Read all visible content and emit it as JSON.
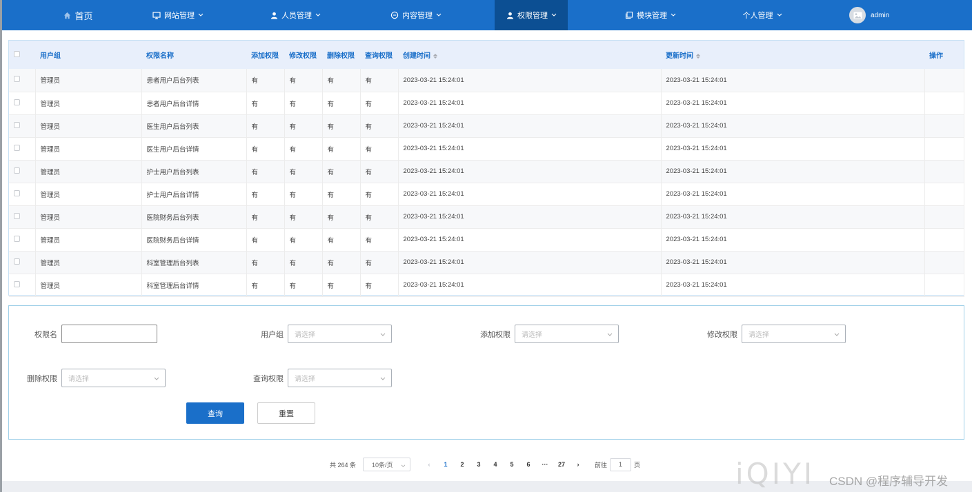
{
  "nav": {
    "home": "首页",
    "site": "网站管理",
    "staff": "人员管理",
    "content": "内容管理",
    "perm": "权限管理",
    "module": "模块管理",
    "personal": "个人管理",
    "user": "admin"
  },
  "table": {
    "headers": [
      "用户组",
      "权限名称",
      "添加权限",
      "修改权限",
      "删除权限",
      "查询权限",
      "创建时间",
      "更新时间",
      "操作"
    ],
    "rows": [
      [
        "管理员",
        "患者用户后台列表",
        "有",
        "有",
        "有",
        "有",
        "2023-03-21 15:24:01",
        "2023-03-21 15:24:01"
      ],
      [
        "管理员",
        "患者用户后台详情",
        "有",
        "有",
        "有",
        "有",
        "2023-03-21 15:24:01",
        "2023-03-21 15:24:01"
      ],
      [
        "管理员",
        "医生用户后台列表",
        "有",
        "有",
        "有",
        "有",
        "2023-03-21 15:24:01",
        "2023-03-21 15:24:01"
      ],
      [
        "管理员",
        "医生用户后台详情",
        "有",
        "有",
        "有",
        "有",
        "2023-03-21 15:24:01",
        "2023-03-21 15:24:01"
      ],
      [
        "管理员",
        "护士用户后台列表",
        "有",
        "有",
        "有",
        "有",
        "2023-03-21 15:24:01",
        "2023-03-21 15:24:01"
      ],
      [
        "管理员",
        "护士用户后台详情",
        "有",
        "有",
        "有",
        "有",
        "2023-03-21 15:24:01",
        "2023-03-21 15:24:01"
      ],
      [
        "管理员",
        "医院财务后台列表",
        "有",
        "有",
        "有",
        "有",
        "2023-03-21 15:24:01",
        "2023-03-21 15:24:01"
      ],
      [
        "管理员",
        "医院财务后台详情",
        "有",
        "有",
        "有",
        "有",
        "2023-03-21 15:24:01",
        "2023-03-21 15:24:01"
      ],
      [
        "管理员",
        "科室管理后台列表",
        "有",
        "有",
        "有",
        "有",
        "2023-03-21 15:24:01",
        "2023-03-21 15:24:01"
      ],
      [
        "管理员",
        "科室管理后台详情",
        "有",
        "有",
        "有",
        "有",
        "2023-03-21 15:24:01",
        "2023-03-21 15:24:01"
      ]
    ]
  },
  "search": {
    "perm_name_label": "权限名",
    "perm_name_value": "",
    "group_label": "用户组",
    "add_label": "添加权限",
    "edit_label": "修改权限",
    "delete_label": "删除权限",
    "query_label": "查询权限",
    "select_placeholder": "请选择",
    "query_btn": "查询",
    "reset_btn": "重置"
  },
  "pager": {
    "total": "共 264 条",
    "page_size": "10条/页",
    "pages": [
      "1",
      "2",
      "3",
      "4",
      "5",
      "6"
    ],
    "ellipsis": "···",
    "last": "27",
    "goto_label": "前往",
    "goto_value": "1",
    "page_unit": "页"
  },
  "watermark": {
    "logo": "iQIYI",
    "csdn": "CSDN @程序辅导开发"
  },
  "colors": {
    "primary": "#1a6fc9",
    "active_nav": "#0c4f93",
    "header_bg": "#e8effb"
  }
}
